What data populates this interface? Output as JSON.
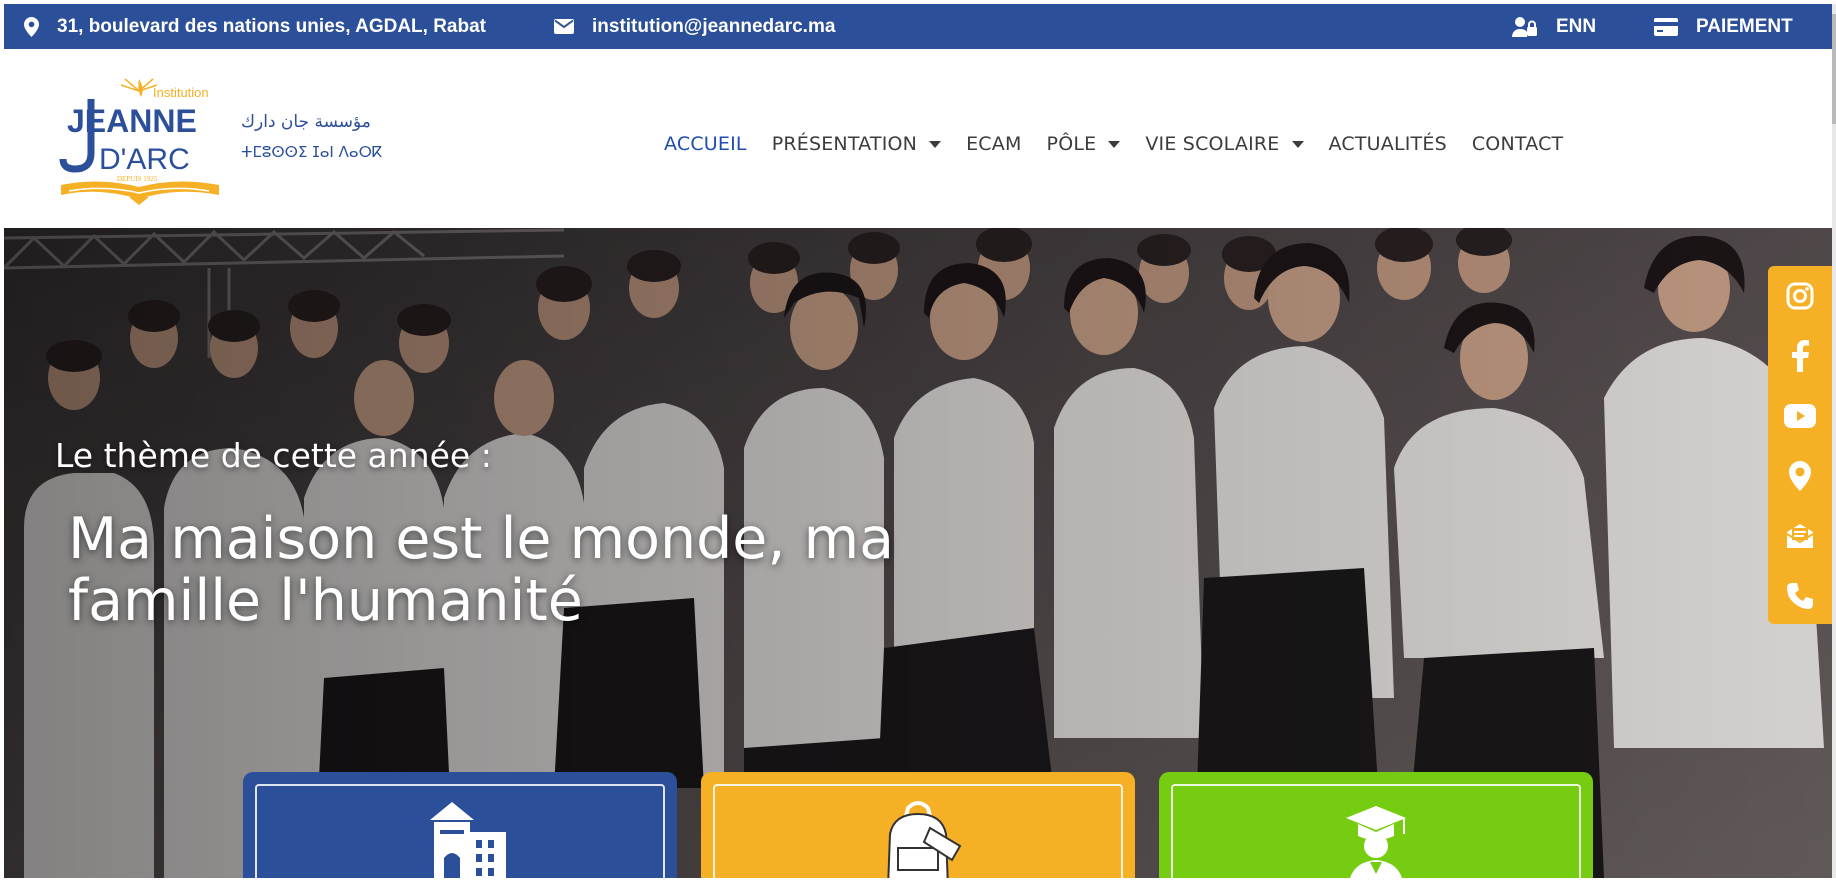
{
  "topbar": {
    "address": "31, boulevard des nations unies, AGDAL, Rabat",
    "email": "institution@jeannedarc.ma",
    "enn": "ENN",
    "payment": "PAIEMENT"
  },
  "logo": {
    "institution": "Institution",
    "name_top": "JEANNE",
    "name_bottom": "D'ARC",
    "since": "DEPUIS 1925",
    "arabic": "مؤسسة جان دارك",
    "tifinagh": "ⵜⵎⵓⵙⵙⵉ ⵊⴰⵏ ⴷⴰⵔⴽ"
  },
  "nav": [
    {
      "label": "ACCUEIL",
      "active": true,
      "dropdown": false
    },
    {
      "label": "PRÉSENTATION",
      "active": false,
      "dropdown": true
    },
    {
      "label": "ECAM",
      "active": false,
      "dropdown": false
    },
    {
      "label": "PÔLE",
      "active": false,
      "dropdown": true
    },
    {
      "label": "VIE SCOLAIRE",
      "active": false,
      "dropdown": true
    },
    {
      "label": "ACTUALITÉS",
      "active": false,
      "dropdown": false
    },
    {
      "label": "CONTACT",
      "active": false,
      "dropdown": false
    }
  ],
  "hero": {
    "subtitle": "Le thème de cette année :",
    "title": "Ma maison est le monde, ma famille l'humanité"
  },
  "social": [
    "instagram-icon",
    "facebook-icon",
    "youtube-icon",
    "location-icon",
    "mail-icon",
    "phone-icon"
  ],
  "cards": [
    {
      "icon": "school-building-icon",
      "color": "#2b4f98"
    },
    {
      "icon": "backpack-icon",
      "color": "#f5b025"
    },
    {
      "icon": "graduate-icon",
      "color": "#76cc11"
    }
  ],
  "colors": {
    "brand_blue": "#2b4f98",
    "accent_yellow": "#f5b025",
    "accent_green": "#76cc11",
    "nav_active": "#1f4db0"
  }
}
